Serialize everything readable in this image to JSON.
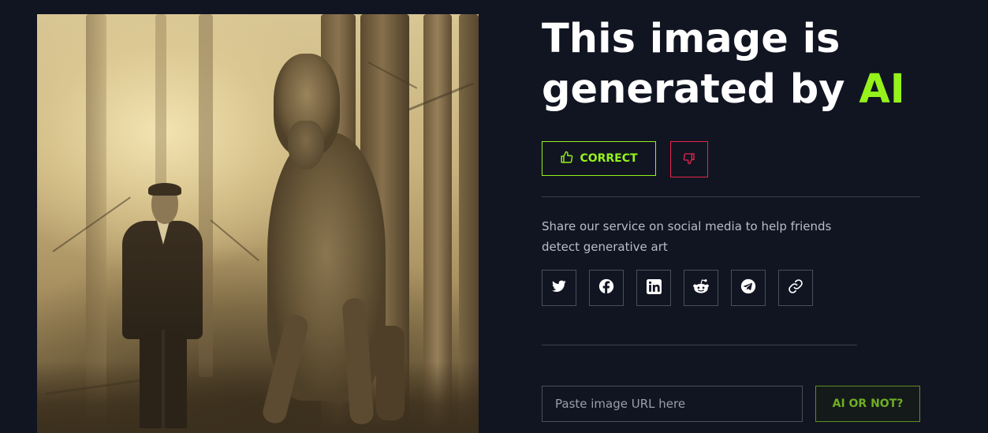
{
  "result": {
    "headline_prefix": "This image is",
    "headline_mid": "generated by ",
    "headline_accent": "AI"
  },
  "feedback": {
    "correct_label": "CORRECT",
    "correct_icon": "thumbs-up-icon",
    "wrong_icon": "thumbs-down-icon"
  },
  "share": {
    "text": "Share our service on social media to help friends detect generative art",
    "networks": [
      "twitter",
      "facebook",
      "linkedin",
      "reddit",
      "telegram",
      "copy-link"
    ]
  },
  "check": {
    "url_placeholder": "Paste image URL here",
    "button_label": "AI OR NOT?"
  },
  "colors": {
    "background": "#111522",
    "accent": "#95f21b",
    "danger": "#e8254a"
  }
}
